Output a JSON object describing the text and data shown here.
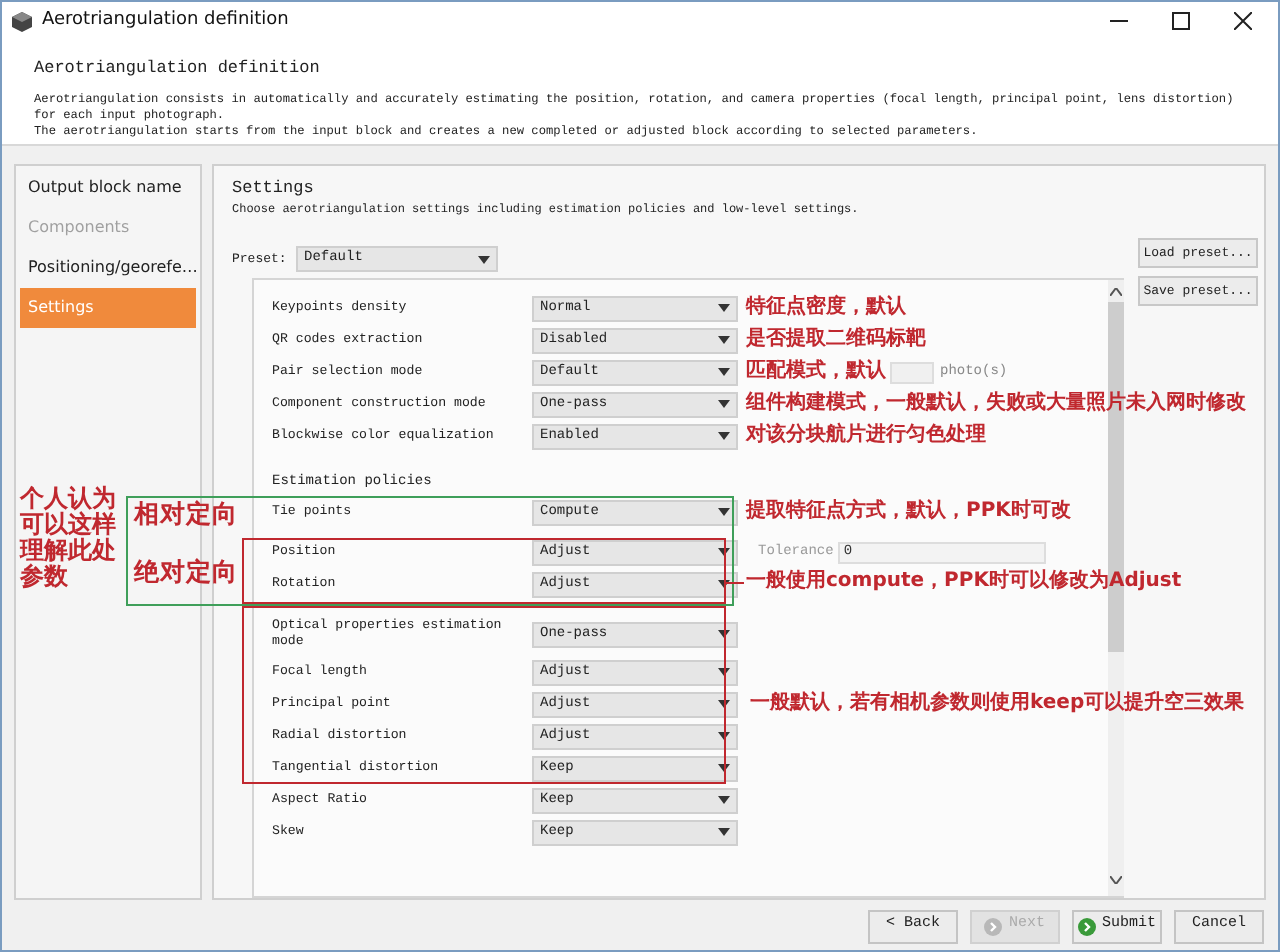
{
  "window": {
    "title": "Aerotriangulation definition"
  },
  "header": {
    "title": "Aerotriangulation definition",
    "paragraphs": [
      "Aerotriangulation consists in automatically and accurately estimating the position, rotation, and camera properties (focal length, principal point, lens distortion) for each input photograph.",
      "The aerotriangulation starts from the input block and creates a new completed or adjusted block according to selected parameters."
    ]
  },
  "sidebar": {
    "items": [
      {
        "label": "Output block name",
        "selected": false,
        "disabled": false
      },
      {
        "label": "Components",
        "selected": false,
        "disabled": true
      },
      {
        "label": "Positioning/georefe…",
        "selected": false,
        "disabled": false
      },
      {
        "label": "Settings",
        "selected": true,
        "disabled": false
      }
    ]
  },
  "settings": {
    "title": "Settings",
    "description": "Choose aerotriangulation settings including estimation policies and low-level settings.",
    "preset": {
      "label": "Preset:",
      "value": "Default"
    },
    "preset_buttons": [
      "Load preset...",
      "Save preset..."
    ],
    "general_rows": [
      {
        "label": "Keypoints density",
        "value": "Normal",
        "note": "特征点密度，默认"
      },
      {
        "label": "QR codes extraction",
        "value": "Disabled",
        "note": "是否提取二维码标靶"
      },
      {
        "label": "Pair selection mode",
        "value": "Default",
        "note": "匹配模式，默认",
        "unit": "photo(s)"
      },
      {
        "label": "Component construction mode",
        "value": "One-pass",
        "note": "组件构建模式，一般默认，失败或大量照片未入网时修改"
      },
      {
        "label": "Blockwise color equalization",
        "value": "Enabled",
        "note": "对该分块航片进行匀色处理"
      }
    ],
    "estimation_title": "Estimation policies",
    "estimation_rows": [
      {
        "label": "Tie points",
        "value": "Compute",
        "note": "提取特征点方式，默认，PPK时可改"
      },
      {
        "label": "Position",
        "value": "Adjust",
        "tolerance": {
          "label": "Tolerance",
          "value": "0"
        }
      },
      {
        "label": "Rotation",
        "value": "Adjust"
      },
      {
        "label": "Optical properties estimation mode",
        "value": "One-pass"
      },
      {
        "label": "Focal length",
        "value": "Adjust"
      },
      {
        "label": "Principal point",
        "value": "Adjust"
      },
      {
        "label": "Radial distortion",
        "value": "Adjust"
      },
      {
        "label": "Tangential distortion",
        "value": "Keep"
      },
      {
        "label": "Aspect Ratio",
        "value": "Keep"
      },
      {
        "label": "Skew",
        "value": "Keep"
      }
    ]
  },
  "annotations": {
    "side_note": "个人认为可以这样理解此处参数",
    "boxes": [
      {
        "color": "#3f9f5a",
        "label": "相对定向"
      },
      {
        "color": "#c0282f",
        "label": "绝对定向",
        "note": "一般使用compute，PPK时可以修改为Adjust"
      },
      {
        "color": "#c0282f",
        "note": "一般默认，若有相机参数则使用keep可以提升空三效果"
      }
    ]
  },
  "footer": {
    "buttons": [
      {
        "label": "< Back",
        "disabled": false,
        "kind": "plain"
      },
      {
        "label": "Next",
        "disabled": true,
        "kind": "icon"
      },
      {
        "label": "Submit",
        "disabled": false,
        "kind": "icon"
      },
      {
        "label": "Cancel",
        "disabled": false,
        "kind": "plain"
      }
    ]
  }
}
